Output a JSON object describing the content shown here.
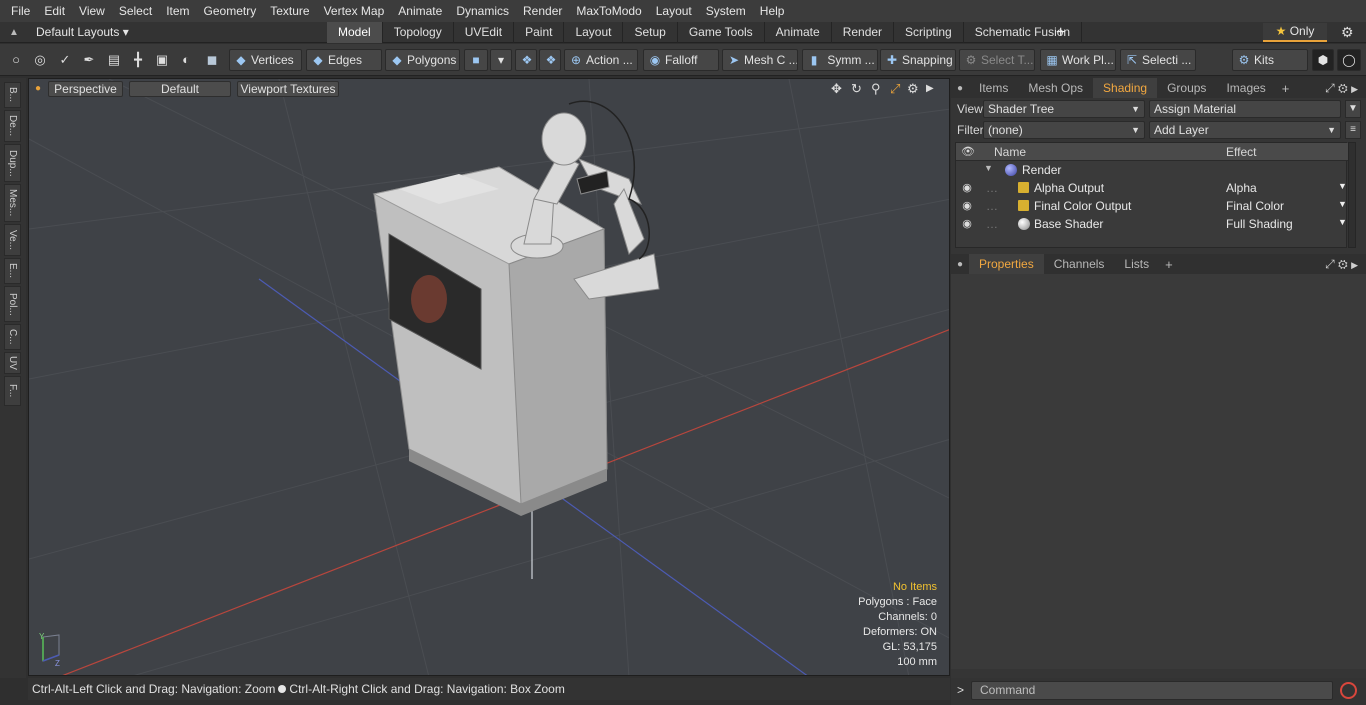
{
  "menu": [
    "File",
    "Edit",
    "View",
    "Select",
    "Item",
    "Geometry",
    "Texture",
    "Vertex Map",
    "Animate",
    "Dynamics",
    "Render",
    "MaxToModo",
    "Layout",
    "System",
    "Help"
  ],
  "layoutbar": {
    "layout_name": "Default Layouts",
    "tabs": [
      "Model",
      "Topology",
      "UVEdit",
      "Paint",
      "Layout",
      "Setup",
      "Game Tools",
      "Animate",
      "Render",
      "Scripting",
      "Schematic Fusion"
    ],
    "active_tab": "Model",
    "add": "+",
    "only_label": "Only",
    "star": "★"
  },
  "toolbar": {
    "vertices": "Vertices",
    "edges": "Edges",
    "polygons": "Polygons",
    "action": "Action",
    "falloff": "Falloff",
    "mesh_c": "Mesh C ...",
    "symm": "Symm ...",
    "snapping": "Snapping",
    "select_t": "Select T...",
    "work_pl": "Work Pl...",
    "selecti": "Selecti ...",
    "kits": "Kits",
    "ellipsis": "..."
  },
  "left_tabs": [
    "B...",
    "De...",
    "Dup...",
    "Mes...",
    "Ve...",
    "E...",
    "Pol...",
    "C...",
    "UV",
    "F..."
  ],
  "viewport": {
    "perspective": "Perspective",
    "default": "Default",
    "textures": "Viewport Textures",
    "stats": {
      "no_items": "No Items",
      "polygons": "Polygons : Face",
      "channels": "Channels: 0",
      "deformers": "Deformers: ON",
      "gl": "GL: 53,175",
      "unit": "100 mm"
    },
    "axis": {
      "y": "Y",
      "z": "Z"
    }
  },
  "status": {
    "left": "Ctrl-Alt-Left Click and Drag: Navigation: Zoom",
    "right": "Ctrl-Alt-Right Click and Drag: Navigation: Box Zoom"
  },
  "right_panel": {
    "top_tabs": [
      "Items",
      "Mesh Ops",
      "Shading",
      "Groups",
      "Images"
    ],
    "active_top_tab": "Shading",
    "view_label": "View",
    "view_value": "Shader Tree",
    "assign_material": "Assign Material",
    "filter_label": "Filter",
    "filter_value": "(none)",
    "add_layer": "Add Layer",
    "col_name": "Name",
    "col_effect": "Effect",
    "tree": [
      {
        "name": "Render",
        "effect": "",
        "icon": "render-sphere"
      },
      {
        "name": "Alpha Output",
        "effect": "Alpha",
        "icon": "output"
      },
      {
        "name": "Final Color Output",
        "effect": "Final Color",
        "icon": "output"
      },
      {
        "name": "Base Shader",
        "effect": "Full Shading",
        "icon": "shader-sphere"
      }
    ],
    "bottom_tabs": [
      "Properties",
      "Channels",
      "Lists"
    ],
    "active_bottom_tab": "Properties",
    "command_placeholder": "Command",
    "prompt": ">"
  },
  "colors": {
    "accent": "#f2a840",
    "red_axis": "#c8473f",
    "blue_axis": "#4858b8",
    "grid": "#4a4d52"
  }
}
